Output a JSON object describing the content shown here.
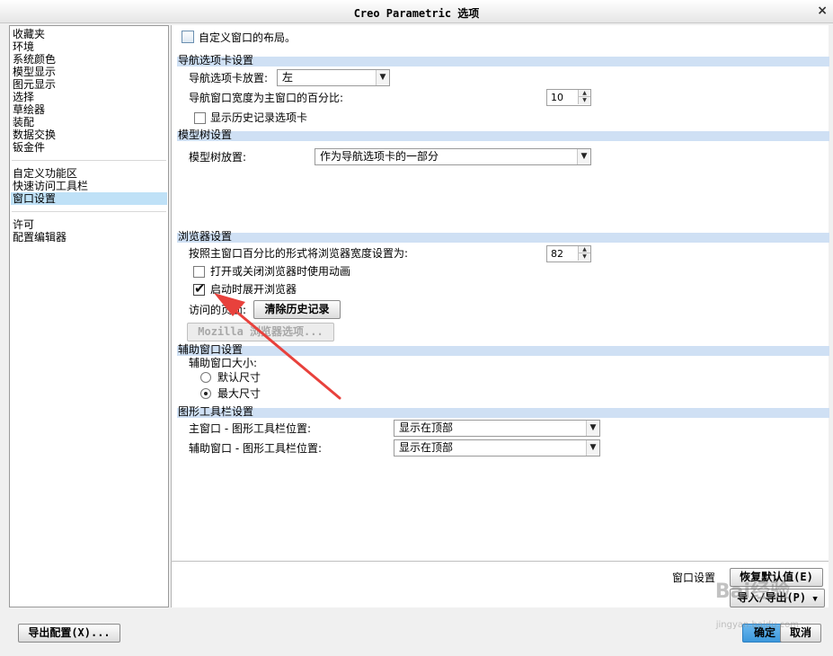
{
  "window": {
    "title": "Creo Parametric 选项",
    "close_glyph": "×"
  },
  "nav": {
    "group1": [
      "收藏夹",
      "环境",
      "系统颜色",
      "模型显示",
      "图元显示",
      "选择",
      "草绘器",
      "装配",
      "数据交换",
      "钣金件"
    ],
    "group2": [
      "自定义功能区",
      "快速访问工具栏",
      "窗口设置"
    ],
    "group3": [
      "许可",
      "配置编辑器"
    ],
    "selected": "窗口设置"
  },
  "header": {
    "customize_label": "自定义窗口的布局。"
  },
  "nav_tab_section": {
    "title": "导航选项卡设置",
    "placement_label": "导航选项卡放置:",
    "placement_value": "左",
    "width_label": "导航窗口宽度为主窗口的百分比:",
    "width_value": "10",
    "history_label": "显示历史记录选项卡",
    "history_checked": false
  },
  "model_tree_section": {
    "title": "模型树设置",
    "placement_label": "模型树放置:",
    "placement_value": "作为导航选项卡的一部分"
  },
  "browser_section": {
    "title": "浏览器设置",
    "width_label": "按照主窗口百分比的形式将浏览器宽度设置为:",
    "width_value": "82",
    "animation_label": "打开或关闭浏览器时使用动画",
    "animation_checked": false,
    "expand_label": "启动时展开浏览器",
    "expand_checked": true,
    "visited_label": "访问的页面:",
    "clear_history_button": "清除历史记录",
    "mozilla_button": "Mozilla 浏览器选项..."
  },
  "aux_section": {
    "title": "辅助窗口设置",
    "size_label": "辅助窗口大小:",
    "options": [
      "默认尺寸",
      "最大尺寸"
    ],
    "selected": "最大尺寸"
  },
  "toolbar_section": {
    "title": "图形工具栏设置",
    "main_label": "主窗口 - 图形工具栏位置:",
    "main_value": "显示在顶部",
    "aux_label": "辅助窗口 - 图形工具栏位置:",
    "aux_value": "显示在顶部"
  },
  "footer": {
    "window_settings_label": "窗口设置",
    "restore_defaults_button": "恢复默认值(E)",
    "import_export_button": "导入/导出(P)",
    "export_config_button": "导出配置(X)...",
    "ok_button": "确定",
    "cancel_button": "取消"
  },
  "watermark": {
    "text": "Bai经验",
    "sub": "jingyan.baidu.com"
  },
  "colors": {
    "section_bar": "#cfe0f4",
    "selection": "#bfe1f7",
    "arrow": "#e8413c",
    "primary_button": "#3c98dc"
  }
}
